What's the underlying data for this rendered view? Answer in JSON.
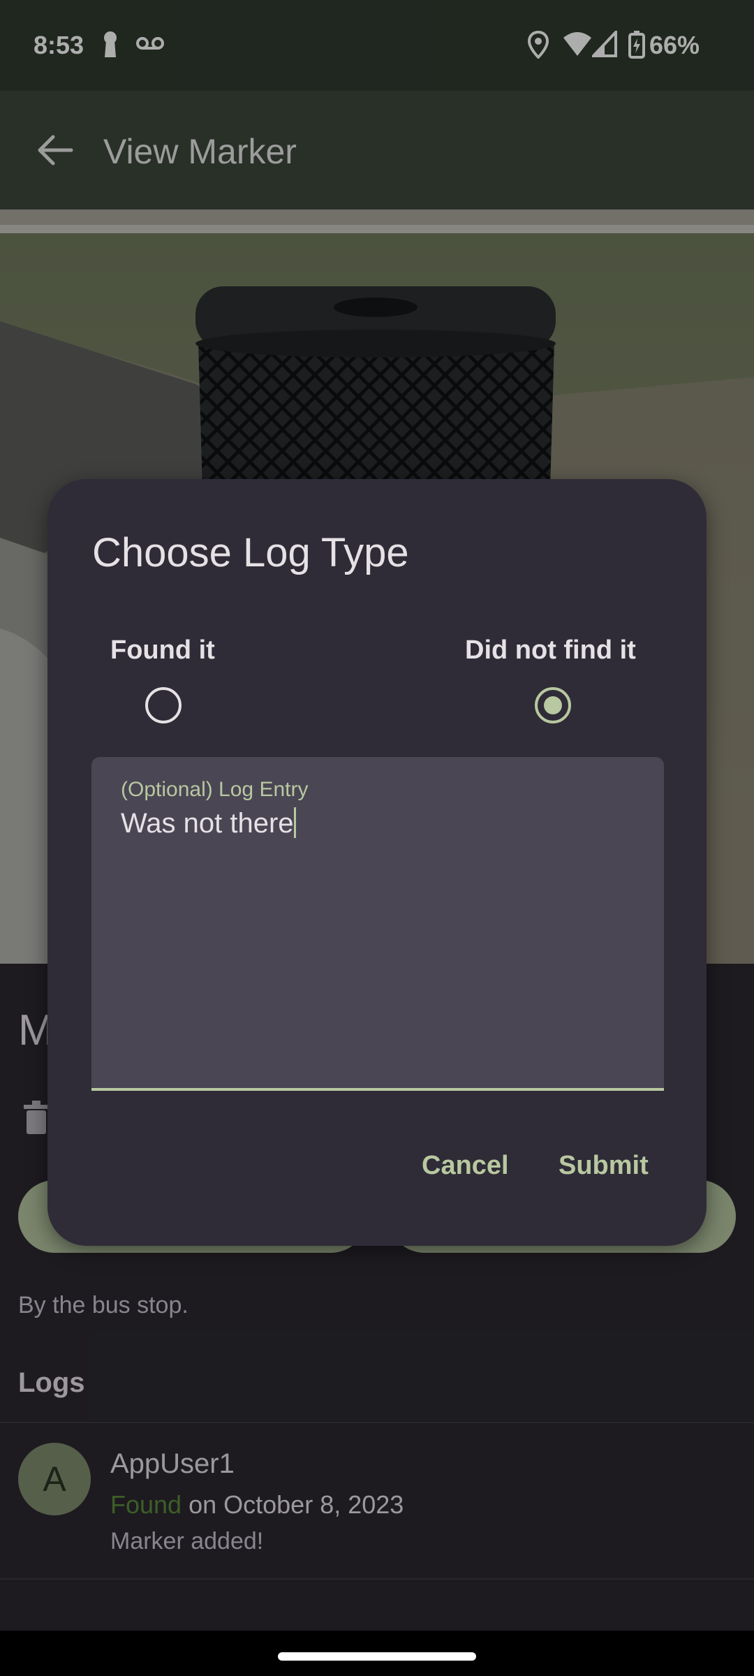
{
  "status_bar": {
    "time": "8:53",
    "battery": "66%",
    "icons": [
      "keyhole-icon",
      "voicemail-icon",
      "location-icon",
      "wifi-icon",
      "signal-icon",
      "battery-charging-icon"
    ]
  },
  "app_bar": {
    "title": "View Marker",
    "back_icon": "arrow-back-icon"
  },
  "marker": {
    "title_partial": "M",
    "description": "By the bus stop."
  },
  "logs": {
    "heading": "Logs",
    "entries": [
      {
        "avatar_letter": "A",
        "user": "AppUser1",
        "status": "Found",
        "date": "on October 8, 2023",
        "text": "Marker added!"
      }
    ]
  },
  "dialog": {
    "title": "Choose Log Type",
    "options": [
      {
        "label": "Found it",
        "selected": false
      },
      {
        "label": "Did not find it",
        "selected": true
      }
    ],
    "field_label": "(Optional) Log Entry",
    "field_value": "Was not there",
    "cancel_label": "Cancel",
    "submit_label": "Submit"
  },
  "colors": {
    "accent": "#b8c8a0",
    "found_green": "#5a8b3a",
    "dialog_bg": "#2f2c37",
    "app_bar": "#3b473b"
  }
}
